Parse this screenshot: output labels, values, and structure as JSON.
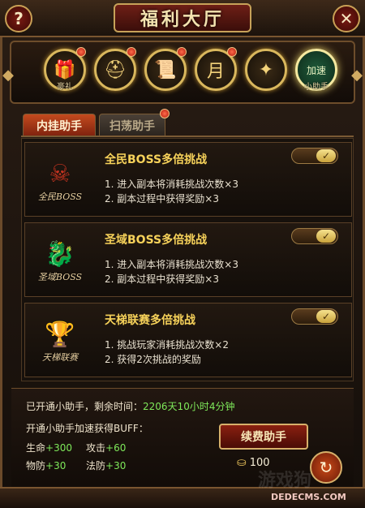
{
  "title": "福利大厅",
  "header": {
    "help_glyph": "?",
    "close_glyph": "✕"
  },
  "features": [
    {
      "label": "豪礼",
      "icon": "gift-icon",
      "glyph": "🎁",
      "badge": true
    },
    {
      "label": "",
      "icon": "helmet-icon",
      "glyph": "⛑",
      "badge": true
    },
    {
      "label": "",
      "icon": "scroll-icon",
      "glyph": "📜",
      "badge": true
    },
    {
      "label": "",
      "icon": "calendar-icon",
      "glyph": "月",
      "badge": true
    },
    {
      "label": "",
      "icon": "crystal-icon",
      "glyph": "✦",
      "badge": false
    },
    {
      "label": "小助手",
      "icon": "assistant-icon",
      "glyph": "加速",
      "badge": false
    }
  ],
  "tabs": [
    {
      "label": "内挂助手",
      "active": true
    },
    {
      "label": "扫荡助手",
      "active": false,
      "badge": true
    }
  ],
  "cards": [
    {
      "emblem_label": "全民BOSS",
      "emblem_icon": "demon-skull-icon",
      "emblem_glyph": "☠",
      "title": "全民BOSS多倍挑战",
      "line1": "1. 进入副本将消耗挑战次数×3",
      "line2": "2. 副本过程中获得奖励×3",
      "toggle": "on"
    },
    {
      "emblem_label": "圣域BOSS",
      "emblem_icon": "dragon-icon",
      "emblem_glyph": "🐉",
      "title": "圣域BOSS多倍挑战",
      "line1": "1. 进入副本将消耗挑战次数×3",
      "line2": "2. 副本过程中获得奖励×3",
      "toggle": "on"
    },
    {
      "emblem_label": "天梯联赛",
      "emblem_icon": "trophy-icon",
      "emblem_glyph": "🏆",
      "title": "天梯联赛多倍挑战",
      "line1": "1. 挑战玩家消耗挑战次数×2",
      "line2": "2. 获得2次挑战的奖励",
      "toggle": "on"
    }
  ],
  "toggle_check": "✓",
  "status": {
    "prefix": "已开通小助手，剩余时间：",
    "time": "2206天10小时4分钟"
  },
  "buff_title": "开通小助手加速获得BUFF：",
  "stats": [
    {
      "name": "生命",
      "value": "+300"
    },
    {
      "name": "攻击",
      "value": "+60"
    },
    {
      "name": "物防",
      "value": "+30"
    },
    {
      "name": "法防",
      "value": "+30"
    }
  ],
  "renew_label": "续费助手",
  "cost": {
    "icon": "gold-ingot-icon",
    "glyph": "⛀",
    "amount": "100"
  },
  "return_glyph": "↻",
  "watermark": "游戏狗",
  "watermark_site": "DEDECMS.COM",
  "colors": {
    "accent_gold": "#f7d25a",
    "accent_green": "#7ee85a",
    "tab_active": "#c34a1e"
  }
}
